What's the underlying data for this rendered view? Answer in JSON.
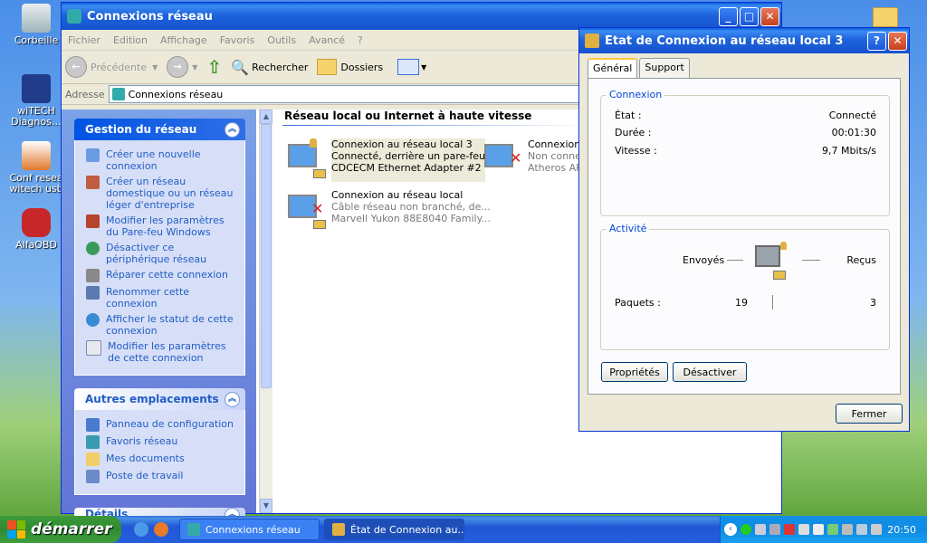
{
  "desktop": {
    "icons": [
      {
        "label": "Corbeille"
      },
      {
        "label": "wiTECH Diagnos…"
      },
      {
        "label": "Conf resea witech usb"
      },
      {
        "label": "AlfaOBD"
      }
    ]
  },
  "window": {
    "title": "Connexions réseau",
    "menu": [
      "Fichier",
      "Edition",
      "Affichage",
      "Favoris",
      "Outils",
      "Avancé",
      "?"
    ],
    "toolbar": {
      "back": "Précédente",
      "search": "Rechercher",
      "folders": "Dossiers"
    },
    "address": {
      "label": "Adresse",
      "value": "Connexions réseau"
    },
    "tasks": {
      "panel1": {
        "title": "Gestion du réseau",
        "items": [
          "Créer une nouvelle connexion",
          "Créer un réseau domestique ou un réseau léger d'entreprise",
          "Modifier les paramètres du Pare-feu Windows",
          "Désactiver ce périphérique réseau",
          "Réparer cette connexion",
          "Renommer cette connexion",
          "Afficher le statut de cette connexion",
          "Modifier les paramètres de cette connexion"
        ]
      },
      "panel2": {
        "title": "Autres emplacements",
        "items": [
          "Panneau de configuration",
          "Favoris réseau",
          "Mes documents",
          "Poste de travail"
        ]
      },
      "panel3": {
        "title": "Détails"
      }
    },
    "group_title": "Réseau local ou Internet à haute vitesse",
    "connections": [
      {
        "name": "Connexion au réseau local 3",
        "status": "Connecté, derrière un pare-feu",
        "device": "CDCECM Ethernet Adapter #2"
      },
      {
        "name": "Connexion",
        "status": "Non conne",
        "device": "Atheros AR"
      },
      {
        "name": "Connexion au réseau local",
        "status": "Câble réseau non branché, de...",
        "device": "Marvell Yukon 88E8040 Family..."
      }
    ]
  },
  "dialog": {
    "title": "État de Connexion au réseau local 3",
    "tabs": [
      "Général",
      "Support"
    ],
    "connexion": {
      "legend": "Connexion",
      "rows": [
        {
          "label": "État :",
          "value": "Connecté"
        },
        {
          "label": "Durée :",
          "value": "00:01:30"
        },
        {
          "label": "Vitesse :",
          "value": "9,7 Mbits/s"
        }
      ]
    },
    "activite": {
      "legend": "Activité",
      "sent_label": "Envoyés",
      "recv_label": "Reçus",
      "packets_label": "Paquets :",
      "sent": "19",
      "recv": "3"
    },
    "buttons": {
      "properties": "Propriétés",
      "disable": "Désactiver",
      "close": "Fermer"
    }
  },
  "taskbar": {
    "start": "démarrer",
    "tasks": [
      "Connexions réseau",
      "État de Connexion au..."
    ],
    "clock": "20:50"
  }
}
